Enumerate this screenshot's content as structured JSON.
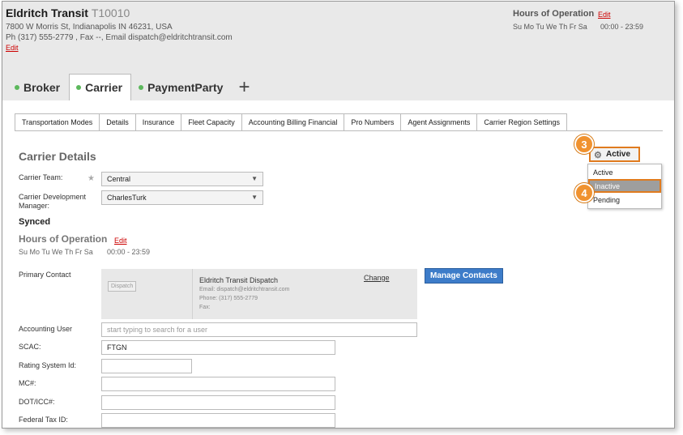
{
  "header": {
    "name": "Eldritch Transit",
    "id": "T10010",
    "address": "7800 W Morris St, Indianapolis IN 46231, USA",
    "contact_line": "Ph (317) 555-2779 , Fax --, Email dispatch@eldritchtransit.com",
    "edit_label": "Edit",
    "hours_title": "Hours of Operation",
    "hours_edit": "Edit",
    "hours_days": "Su Mo Tu We Th Fr Sa",
    "hours_time": "00:00 - 23:59"
  },
  "top_tabs": [
    {
      "label": "Broker",
      "dot_color": "#5cb85c"
    },
    {
      "label": "Carrier",
      "dot_color": "#5cb85c"
    },
    {
      "label": "PaymentParty",
      "dot_color": "#5cb85c"
    }
  ],
  "add_tab_label": "+",
  "sub_tabs": [
    "Transportation Modes",
    "Details",
    "Insurance",
    "Fleet Capacity",
    "Accounting Billing Financial",
    "Pro Numbers",
    "Agent Assignments",
    "Carrier Region Settings"
  ],
  "active_sub_tab": "Details",
  "details": {
    "title": "Carrier Details",
    "team_label": "Carrier Team:",
    "team_required": "★",
    "team_value": "Central",
    "dev_mgr_label_1": "Carrier Development",
    "dev_mgr_label_2": "Manager:",
    "dev_mgr_value": "CharlesTurk",
    "synced": "Synced",
    "hours_title": "Hours of Operation",
    "hours_edit": "Edit",
    "hours_days": "Su Mo Tu We Th Fr Sa",
    "hours_time": "00:00 - 23:59",
    "primary_contact_label": "Primary Contact",
    "contact": {
      "badge": "Dispatch",
      "name": "Eldritch Transit Dispatch",
      "email": "Email: dispatch@eldritchtransit.com",
      "phone": "Phone: (317) 555-2779",
      "fax": "Fax:",
      "change_label": "Change"
    },
    "manage_contacts_label": "Manage Contacts",
    "accounting_user_label": "Accounting User",
    "accounting_user_placeholder": "start typing to search for a user",
    "scac_label": "SCAC:",
    "scac_value": "FTGN",
    "rating_label": "Rating System Id:",
    "rating_value": "",
    "mc_label": "MC#:",
    "mc_value": "",
    "dot_label": "DOT/ICC#:",
    "dot_value": "",
    "tax_label": "Federal Tax ID:",
    "tax_value": ""
  },
  "status": {
    "current": "Active",
    "options": [
      "Active",
      "Inactive",
      "Pending"
    ],
    "highlighted": "Inactive"
  },
  "callouts": [
    "3",
    "4"
  ],
  "colors": {
    "active_dot": "#5cb85c",
    "accent_orange": "#e07b1e",
    "link_red": "#cc0000",
    "button_blue": "#3d7cc9"
  }
}
